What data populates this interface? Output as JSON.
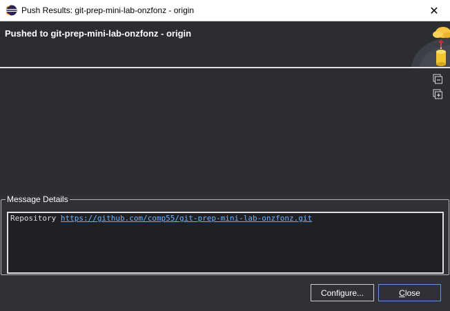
{
  "window": {
    "title": "Push Results: git-prep-mini-lab-onzfonz - origin",
    "close_glyph": "✕",
    "app_icon": "eclipse-icon"
  },
  "header": {
    "heading": "Pushed to git-prep-mini-lab-onzfonz - origin",
    "art_icon": "push-to-cloud-icon"
  },
  "toolbar": {
    "collapse_icon": "collapse-all-icon",
    "expand_icon": "expand-all-icon"
  },
  "message_details": {
    "legend": "Message Details",
    "prefix": "Repository ",
    "url": "https://github.com/comp55/git-prep-mini-lab-onzfonz.git"
  },
  "buttons": {
    "configure": "Configure...",
    "close_first": "C",
    "close_rest": "lose"
  },
  "colors": {
    "accent": "#5b9bd5",
    "link": "#6fb3ff",
    "background": "#2f3136"
  }
}
